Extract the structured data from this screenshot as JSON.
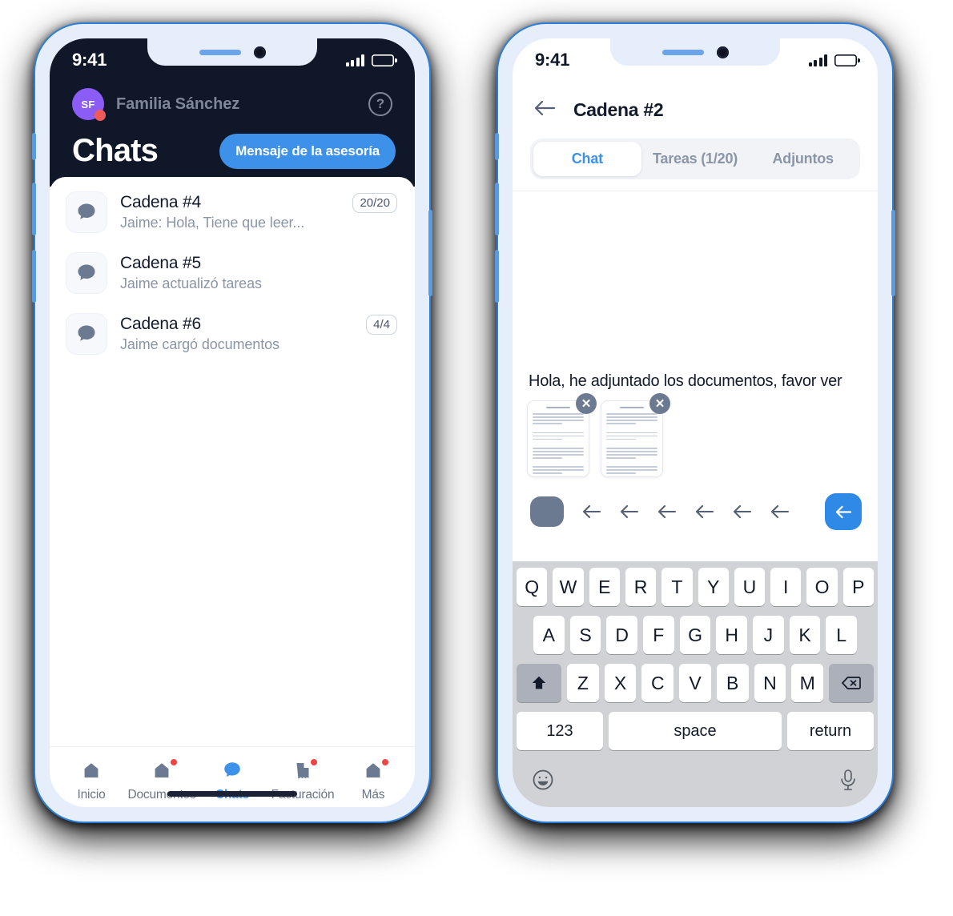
{
  "left_phone": {
    "status": {
      "time": "9:41",
      "signal_icon": "cellular-bars-icon",
      "battery_icon": "battery-icon"
    },
    "org": {
      "avatar_initials": "SF",
      "name": "Familia Sánchez",
      "help_icon": "help-circle-icon"
    },
    "header": {
      "title": "Chats",
      "cta_label": "Mensaje de la asesoría"
    },
    "chats": [
      {
        "icon": "chat-bubble-icon",
        "title": "Cadena #4",
        "subtitle": "Jaime: Hola, Tiene que leer...",
        "badge": "20/20"
      },
      {
        "icon": "chat-bubble-icon",
        "title": "Cadena #5",
        "subtitle": "Jaime actualizó tareas",
        "badge": ""
      },
      {
        "icon": "chat-bubble-icon",
        "title": "Cadena #6",
        "subtitle": "Jaime cargó documentos",
        "badge": "4/4"
      }
    ],
    "tabs": [
      {
        "label": "Inicio",
        "icon": "home-icon",
        "active": false,
        "badge": false
      },
      {
        "label": "Documentos",
        "icon": "home-icon",
        "active": false,
        "badge": true
      },
      {
        "label": "Chats",
        "icon": "chat-bubble-icon",
        "active": true,
        "badge": false
      },
      {
        "label": "Facturación",
        "icon": "invoice-icon",
        "active": false,
        "badge": true
      },
      {
        "label": "Más",
        "icon": "home-icon",
        "active": false,
        "badge": true
      }
    ]
  },
  "right_phone": {
    "status": {
      "time": "9:41",
      "signal_icon": "cellular-bars-icon",
      "battery_icon": "battery-icon"
    },
    "header": {
      "back_icon": "arrow-left-icon",
      "title": "Cadena #2"
    },
    "segmented": [
      {
        "label": "Chat",
        "active": true
      },
      {
        "label": "Tareas (1/20)",
        "active": false
      },
      {
        "label": "Adjuntos",
        "active": false
      }
    ],
    "composer": {
      "message": "Hola, he adjuntado los documentos, favor ver",
      "attachments": [
        {
          "name": "document-thumbnail",
          "remove_icon": "close-icon"
        },
        {
          "name": "document-thumbnail",
          "remove_icon": "close-icon"
        }
      ],
      "toolbar_icons": [
        "attachment-pill",
        "arrow-left-icon",
        "arrow-left-icon",
        "arrow-left-icon",
        "arrow-left-icon",
        "arrow-left-icon",
        "arrow-left-icon"
      ],
      "send_icon": "arrow-left-icon"
    },
    "keyboard": {
      "row1": [
        "Q",
        "W",
        "E",
        "R",
        "T",
        "Y",
        "U",
        "I",
        "O",
        "P"
      ],
      "row2": [
        "A",
        "S",
        "D",
        "F",
        "G",
        "H",
        "J",
        "K",
        "L"
      ],
      "row3": [
        "Z",
        "X",
        "C",
        "V",
        "B",
        "N",
        "M"
      ],
      "shift_icon": "shift-up-icon",
      "backspace_icon": "backspace-icon",
      "numbers_label": "123",
      "space_label": "space",
      "return_label": "return",
      "emoji_icon": "smiley-icon",
      "mic_icon": "microphone-icon"
    }
  },
  "colors": {
    "dark_header": "#101729",
    "accent_blue": "#3d91e8",
    "avatar_purple": "#8b5cf6",
    "badge_red": "#f04545",
    "muted_text": "#8b95a8",
    "frame_bezel": "#e6eefb",
    "frame_outline": "#2d7ddb",
    "keyboard_bg": "#d0d2d6"
  }
}
